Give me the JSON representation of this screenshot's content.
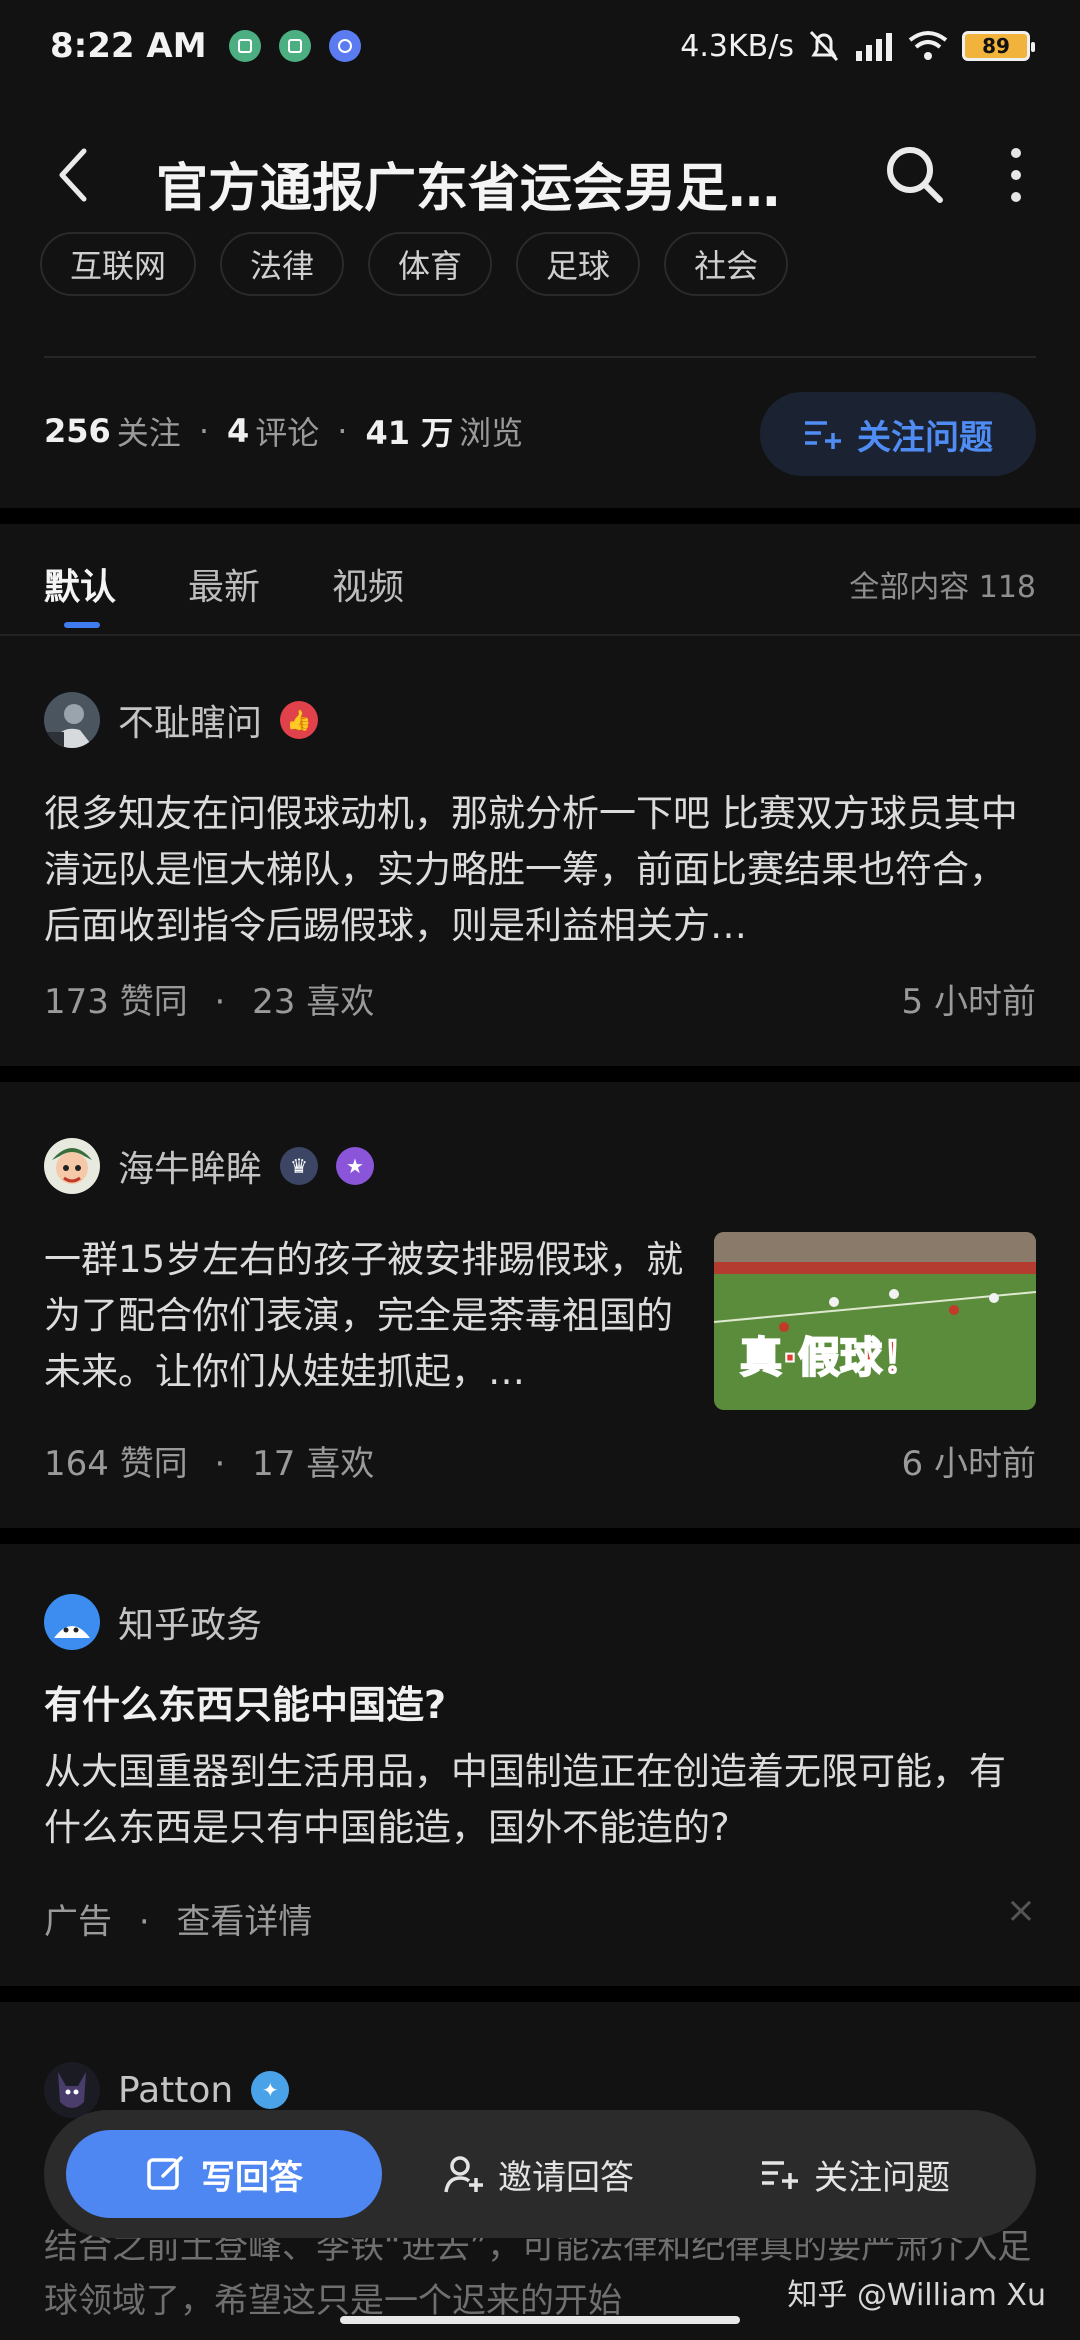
{
  "status_bar": {
    "time": "8:22 AM",
    "network_speed": "4.3KB/s",
    "battery": "89",
    "icons": [
      "app-notification-icon",
      "app-notification-icon",
      "chat-notification-icon",
      "mute-bell-icon",
      "signal-icon",
      "wifi-icon",
      "battery-icon"
    ]
  },
  "header": {
    "title": "官方通报广东省运会男足…",
    "icons": [
      "back-arrow-icon",
      "search-icon",
      "more-vertical-icon"
    ]
  },
  "tags": [
    "互联网",
    "法律",
    "体育",
    "足球",
    "社会"
  ],
  "stats": {
    "followers_count": "256",
    "followers_label": "关注",
    "comments_count": "4",
    "comments_label": "评论",
    "views_count": "41 万",
    "views_label": "浏览",
    "separator": "·",
    "follow_button": "关注问题"
  },
  "tabs": {
    "items": [
      "默认",
      "最新",
      "视频"
    ],
    "active": "默认",
    "total": "全部内容 118"
  },
  "answers": [
    {
      "author": "不耻瞎问",
      "excerpt": "很多知友在问假球动机，那就分析一下吧 比赛双方球员其中清远队是恒大梯队，实力略胜一筹，前面比赛结果也符合，后面收到指令后踢假球，则是利益相关方…",
      "upvotes": "173",
      "upvotes_label": "赞同",
      "likes": "23",
      "likes_label": "喜欢",
      "time": "5 小时前"
    },
    {
      "author": "海牛眸眸",
      "excerpt": "一群15岁左右的孩子被安排踢假球，就为了配合你们表演，完全是荼毒祖国的未来。让你们从娃娃抓起，…",
      "thumbnail_caption": "真·假球！",
      "upvotes": "164",
      "upvotes_label": "赞同",
      "likes": "17",
      "likes_label": "喜欢",
      "time": "6 小时前"
    }
  ],
  "ad": {
    "author": "知乎政务",
    "title": "有什么东西只能中国造?",
    "body": "从大国重器到生活用品，中国制造正在创造着无限可能，有什么东西是只有中国能造，国外不能造的?",
    "label": "广告",
    "detail": "查看详情",
    "close": "×"
  },
  "partial_answer": {
    "author": "Patton",
    "text_behind": "结合之前土登峰、李铁“进去”，可能法律和纪律真的要严肃介入足球领域了，希望这只是一个迟来的开始"
  },
  "bottom_bar": {
    "write": "写回答",
    "invite": "邀请回答",
    "follow": "关注问题"
  },
  "watermark": "知乎 @William Xu",
  "colors": {
    "background": "#121212",
    "accent": "#4e86f2",
    "follow_button_bg": "#1b2333"
  }
}
